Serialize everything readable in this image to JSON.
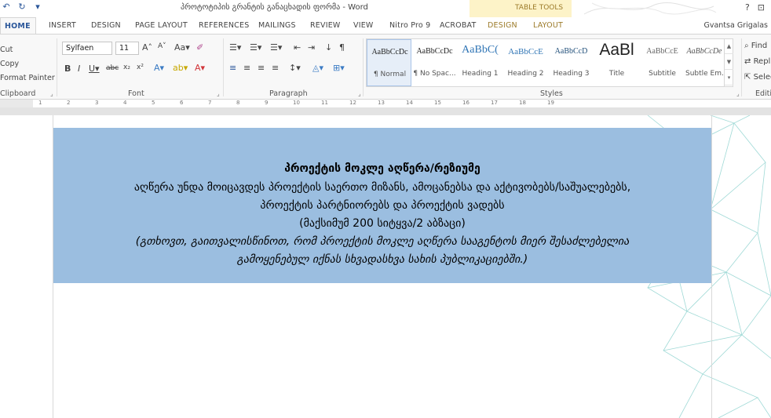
{
  "window": {
    "title": "პროტოტიპის გრანტის განაცხადის ფორმა - Word",
    "context_tab_group": "TABLE TOOLS",
    "user": "Gvantsa Grigalas"
  },
  "tabs": [
    "HOME",
    "INSERT",
    "DESIGN",
    "PAGE LAYOUT",
    "REFERENCES",
    "MAILINGS",
    "REVIEW",
    "VIEW",
    "Nitro Pro 9",
    "ACROBAT",
    "DESIGN",
    "LAYOUT"
  ],
  "clipboard": {
    "cut": "Cut",
    "copy": "Copy",
    "format_painter": "Format Painter",
    "label": "Clipboard"
  },
  "font": {
    "name": "Sylfaen",
    "size": "11",
    "label": "Font"
  },
  "paragraph": {
    "label": "Paragraph"
  },
  "styles": {
    "label": "Styles",
    "items": [
      {
        "preview": "AaBbCcDc",
        "name": "¶ Normal"
      },
      {
        "preview": "AaBbCcDc",
        "name": "¶ No Spac..."
      },
      {
        "preview": "AaBbC(",
        "name": "Heading 1"
      },
      {
        "preview": "AaBbCcE",
        "name": "Heading 2"
      },
      {
        "preview": "AaBbCcD",
        "name": "Heading 3"
      },
      {
        "preview": "AaBl",
        "name": "Title"
      },
      {
        "preview": "AaBbCcE",
        "name": "Subtitle"
      },
      {
        "preview": "AaBbCcDe",
        "name": "Subtle Em..."
      }
    ]
  },
  "editing": {
    "find": "Find",
    "replace": "Replace",
    "select": "Select",
    "label": "Editing"
  },
  "ruler": {
    "numbers": [
      "1",
      "2",
      "3",
      "4",
      "5",
      "6",
      "7",
      "8",
      "9",
      "10",
      "11",
      "12",
      "13",
      "14",
      "15",
      "16",
      "17",
      "18",
      "19"
    ]
  },
  "document": {
    "heading": "პროექტის მოკლე აღწერა/რეზიუმე",
    "line1": "აღწერა უნდა მოიცავდეს პროექტის საერთო მიზანს, ამოცანებსა და აქტივობებს/საშუალებებს,",
    "line2": "პროექტის პარტნიორებს და პროექტის ვადებს",
    "line3": "(მაქსიმუმ 200 სიტყვა/2 აბზაცი)",
    "note1": "(გთხოვთ, გაითვალისწინოთ, რომ პროექტის მოკლე აღწერა სააგენტოს მიერ შესაძლებელია",
    "note2": "გამოყენებულ იქნას სხვადასხვა სახის პუბლიკაციებში.)"
  },
  "colors": {
    "accent": "#2b579a",
    "table_cell_fill": "#9bbee0",
    "context_tab": "#fdf3c8"
  }
}
